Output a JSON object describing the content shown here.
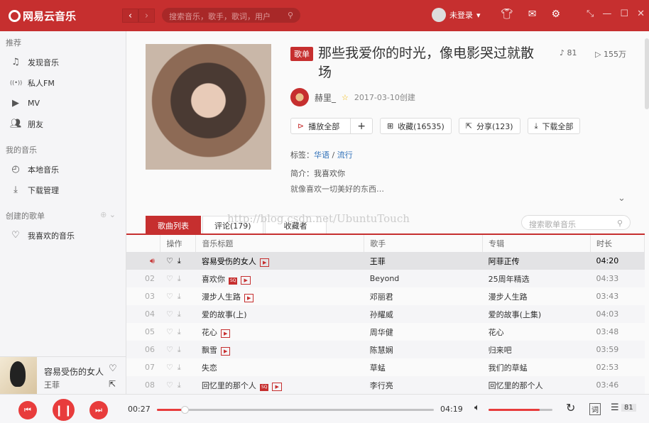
{
  "app": {
    "logo": "网易云音乐",
    "search_placeholder": "搜索音乐，歌手，歌词，用户",
    "user": "未登录"
  },
  "colors": {
    "brand": "#c62f2f",
    "accent": "#e83c3c"
  },
  "sidebar": {
    "sections": [
      {
        "title": "推荐",
        "items": [
          {
            "icon": "music-note-icon",
            "label": "发现音乐"
          },
          {
            "icon": "radio-icon",
            "label": "私人FM"
          },
          {
            "icon": "video-icon",
            "label": "MV"
          },
          {
            "icon": "friends-icon",
            "label": "朋友"
          }
        ]
      },
      {
        "title": "我的音乐",
        "items": [
          {
            "icon": "clock-icon",
            "label": "本地音乐"
          },
          {
            "icon": "download-icon",
            "label": "下载管理"
          }
        ]
      },
      {
        "title": "创建的歌单",
        "items": [
          {
            "icon": "heart-icon",
            "label": "我喜欢的音乐"
          }
        ]
      }
    ]
  },
  "now_playing": {
    "title": "容易受伤的女人",
    "artist": "王菲"
  },
  "playlist": {
    "badge": "歌单",
    "title": "那些我爱你的时光，像电影哭过就散场",
    "song_count": "81",
    "play_count": "155万",
    "creator": "赫里_",
    "created": "2017-03-10创建",
    "buttons": {
      "play_all": "播放全部",
      "add": "+",
      "collect": "收藏(16535)",
      "share": "分享(123)",
      "download": "下载全部"
    },
    "tags_label": "标签：",
    "tags": [
      "华语",
      "流行"
    ],
    "tag_sep": "/",
    "intro_label": "简介：",
    "intro_line1": "我喜欢你",
    "intro_line2": "就像喜欢一切美好的东西…"
  },
  "tabs": [
    "歌曲列表",
    "评论(179)",
    "收藏者"
  ],
  "watermark": "http://blog.csdn.net/UbuntuTouch",
  "table_search_placeholder": "搜索歌单音乐",
  "columns": [
    "",
    "操作",
    "音乐标题",
    "歌手",
    "专辑",
    "时长"
  ],
  "songs": [
    {
      "no": "",
      "title": "容易受伤的女人",
      "sq": false,
      "mv": true,
      "artist": "王菲",
      "album": "阿菲正传",
      "duration": "04:20",
      "playing": true
    },
    {
      "no": "02",
      "title": "喜欢你",
      "sq": true,
      "mv": true,
      "artist": "Beyond",
      "album": "25周年精选",
      "duration": "04:33"
    },
    {
      "no": "03",
      "title": "漫步人生路",
      "sq": false,
      "mv": true,
      "artist": "邓丽君",
      "album": "漫步人生路",
      "duration": "03:43"
    },
    {
      "no": "04",
      "title": "爱的故事(上)",
      "sq": false,
      "mv": false,
      "artist": "孙耀威",
      "album": "爱的故事(上集)",
      "duration": "04:03"
    },
    {
      "no": "05",
      "title": "花心",
      "sq": false,
      "mv": true,
      "artist": "周华健",
      "album": "花心",
      "duration": "03:48"
    },
    {
      "no": "06",
      "title": "飘雪",
      "sq": false,
      "mv": true,
      "artist": "陈慧娴",
      "album": "归来吧",
      "duration": "03:59"
    },
    {
      "no": "07",
      "title": "失恋",
      "sq": false,
      "mv": false,
      "artist": "草蜢",
      "album": "我们的草蜢",
      "duration": "02:53"
    },
    {
      "no": "08",
      "title": "回忆里的那个人",
      "sq": true,
      "mv": true,
      "artist": "李行亮",
      "album": "回忆里的那个人",
      "duration": "03:46"
    }
  ],
  "player": {
    "elapsed": "00:27",
    "total": "04:19",
    "progress_percent": 10,
    "volume_percent": 80,
    "lyrics": "词",
    "queue_count": "81"
  }
}
